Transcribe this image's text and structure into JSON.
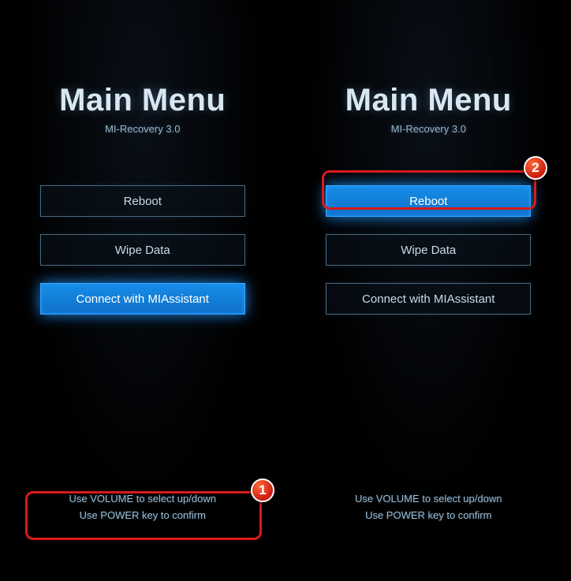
{
  "common": {
    "title": "Main Menu",
    "subtitle": "MI-Recovery 3.0",
    "hint_line1": "Use VOLUME to select up/down",
    "hint_line2": "Use POWER key to confirm"
  },
  "menu_labels": {
    "reboot": "Reboot",
    "wipe": "Wipe Data",
    "connect": "Connect with MIAssistant"
  },
  "callouts": {
    "badge1": "1",
    "badge2": "2"
  },
  "left_selected": "connect",
  "right_selected": "reboot"
}
